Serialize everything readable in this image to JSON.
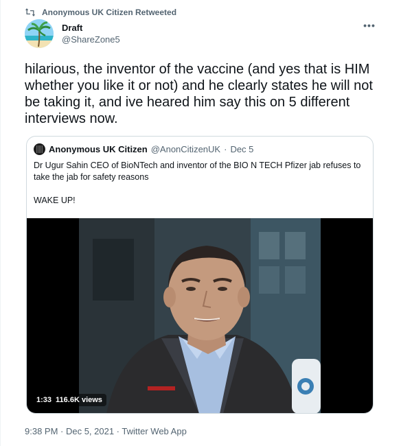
{
  "retweet_banner": {
    "text": "Anonymous UK Citizen Retweeted",
    "icon": "retweet-icon"
  },
  "author": {
    "display_name": "Draft",
    "handle": "@ShareZone5",
    "avatar_icon": "palm-beach-avatar"
  },
  "more_menu": {
    "label": "•••",
    "icon": "more-icon"
  },
  "tweet": {
    "text": "hilarious, the inventor of the vaccine (and yes that is HIM whether you like it or not) and he clearly states he will not be taking it, and ive heared him say this on 5 different interviews now."
  },
  "quote": {
    "display_name": "Anonymous UK Citizen",
    "handle": "@AnonCitizenUK",
    "separator": "·",
    "date": "Dec 5",
    "body_line1": "Dr Ugur Sahin CEO of BioNTech and inventor of the BIO N TECH Pfizer jab refuses to take the jab for safety reasons",
    "body_line2": "WAKE UP!",
    "video": {
      "duration": "1:33",
      "views": "116.6K views"
    }
  },
  "footer": {
    "timestamp": "9:38 PM · Dec 5, 2021 · Twitter Web App"
  },
  "colors": {
    "text_primary": "#0f1419",
    "text_secondary": "#536471",
    "border": "#cfd9de"
  }
}
